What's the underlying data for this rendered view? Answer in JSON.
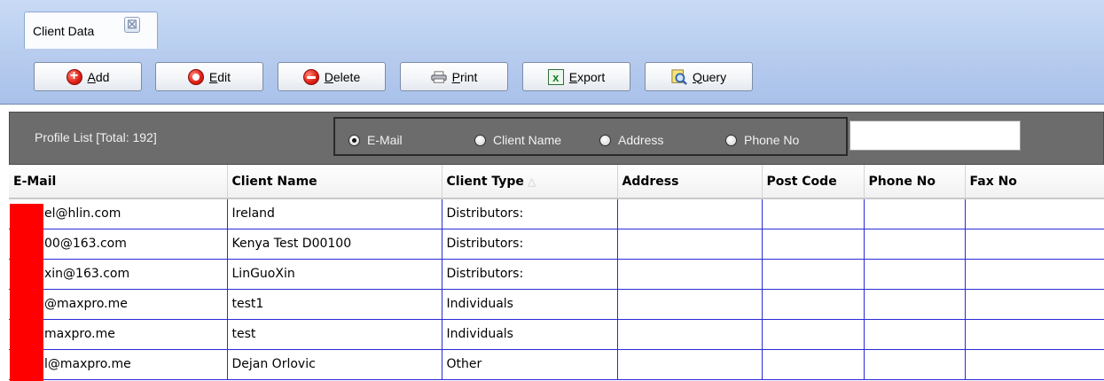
{
  "tab": {
    "label": "Client Data",
    "close_glyph": "☒"
  },
  "toolbar": {
    "buttons": [
      {
        "key": "A",
        "rest": "dd",
        "icon": "add-icon"
      },
      {
        "key": "E",
        "rest": "dit",
        "icon": "edit-icon"
      },
      {
        "key": "D",
        "rest": "elete",
        "icon": "delete-icon"
      },
      {
        "key": "P",
        "rest": "rint",
        "icon": "printer-icon"
      },
      {
        "key": "E",
        "rest": "xport",
        "icon": "excel-export-icon"
      },
      {
        "key": "Q",
        "rest": "uery",
        "icon": "magnifier-query-icon"
      }
    ]
  },
  "filter": {
    "profile_label": "Profile List  [Total:  192]",
    "options": [
      "E-Mail",
      "Client Name",
      "Address",
      "Phone No"
    ],
    "selected": "E-Mail",
    "search_value": ""
  },
  "grid": {
    "columns": [
      "E-Mail",
      "Client Name",
      "Client Type",
      "Address",
      "Post Code",
      "Phone No",
      "Fax No"
    ],
    "sort_column": "Client Type",
    "sort_glyph": "△",
    "rows": [
      [
        "el@hlin.com",
        "Ireland",
        "Distributors:",
        "",
        "",
        "",
        ""
      ],
      [
        "00@163.com",
        "Kenya Test D00100",
        "Distributors:",
        "",
        "",
        "",
        ""
      ],
      [
        "xin@163.com",
        "LinGuoXin",
        "Distributors:",
        "",
        "",
        "",
        ""
      ],
      [
        "@maxpro.me",
        "test1",
        "Individuals",
        "",
        "",
        "",
        ""
      ],
      [
        "maxpro.me",
        "test",
        "Individuals",
        "",
        "",
        "",
        ""
      ],
      [
        "l@maxpro.me",
        "Dejan Orlovic",
        "Other",
        "",
        "",
        "",
        ""
      ]
    ]
  },
  "colors": {
    "grid_line": "#2b2bd6",
    "filter_bg": "#6c6c6c",
    "toolbar_bg": "#b9cdee",
    "redaction": "#ff0000"
  }
}
